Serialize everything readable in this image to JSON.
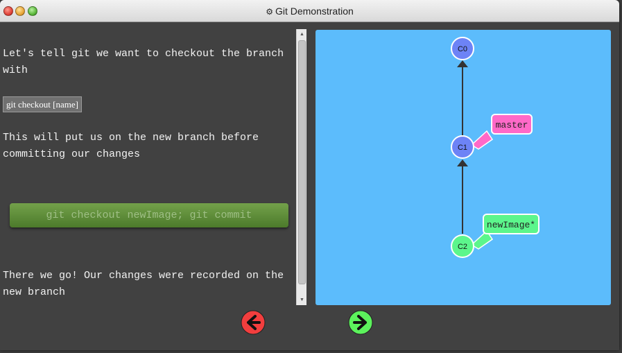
{
  "window": {
    "title": "Git Demonstration",
    "title_icon": "gear-icon"
  },
  "content": {
    "para1": "Let's tell git we want to checkout the branch with",
    "code": "git checkout [name]",
    "para2": "This will put us on the new branch before committing our changes",
    "command": "git checkout newImage; git commit",
    "para3": "There we go! Our changes were recorded on the new branch"
  },
  "graph": {
    "commits": [
      "C0",
      "C1",
      "C2"
    ],
    "branches": [
      {
        "name": "master",
        "target": "C1",
        "color": "#ff69c8"
      },
      {
        "name": "newImage*",
        "target": "C2",
        "color": "#5cf68c"
      }
    ]
  },
  "nav": {
    "back_icon": "arrow-left-icon",
    "forward_icon": "arrow-right-icon"
  },
  "colors": {
    "viz_background": "#5cbcfc",
    "commit_default": "#6d83f6",
    "commit_head": "#5cf68c",
    "back_button": "#f23e3e",
    "forward_button": "#5cf25c"
  }
}
